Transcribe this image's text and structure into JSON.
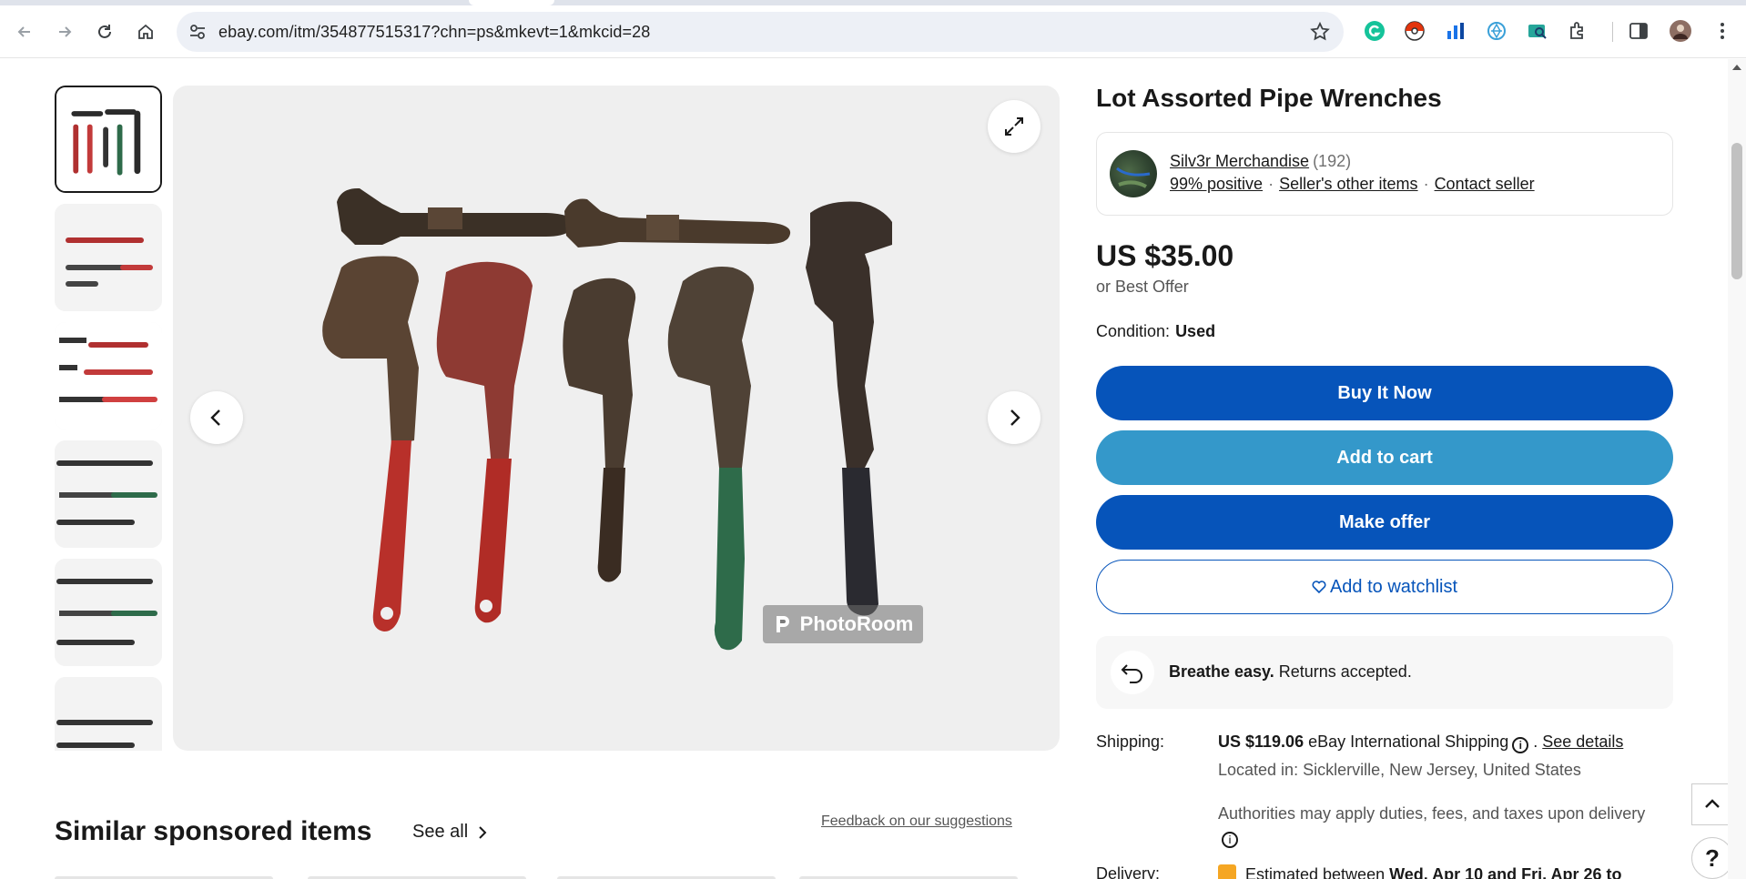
{
  "browser": {
    "url": "ebay.com/itm/354877515317?chn=ps&mkevt=1&mkcid=28",
    "extensions": [
      "grammarly-icon",
      "pokeball-icon",
      "chart-icon",
      "gem-icon",
      "search-extension-icon",
      "puzzle-icon"
    ]
  },
  "gallery": {
    "thumbnail_count": 6,
    "watermark": "PhotoRoom"
  },
  "listing": {
    "title": "Lot Assorted Pipe Wrenches",
    "seller": {
      "name": "Silv3r Merchandise",
      "feedback_count": "(192)",
      "positive": "99% positive",
      "other_items": "Seller's other items",
      "contact": "Contact seller"
    },
    "price": "US $35.00",
    "best_offer": "or Best Offer",
    "condition_label": "Condition:",
    "condition_value": "Used",
    "buttons": {
      "buy_now": "Buy It Now",
      "add_to_cart": "Add to cart",
      "make_offer": "Make offer",
      "watchlist": "Add to watchlist"
    },
    "returns": {
      "bold": "Breathe easy.",
      "rest": " Returns accepted."
    },
    "shipping": {
      "label": "Shipping:",
      "amount": "US $119.06",
      "method": " eBay International Shipping",
      "separator": " . ",
      "see_details": "See details",
      "located": "Located in: Sicklerville, New Jersey, United States",
      "duties": "Authorities may apply duties, fees, and taxes upon delivery"
    },
    "delivery": {
      "label": "Delivery:",
      "prefix": "Estimated between ",
      "dates": "Wed, Apr 10 and Fri, Apr 26 to"
    }
  },
  "similar": {
    "title": "Similar sponsored items",
    "see_all": "See all",
    "feedback": "Feedback on our suggestions"
  }
}
